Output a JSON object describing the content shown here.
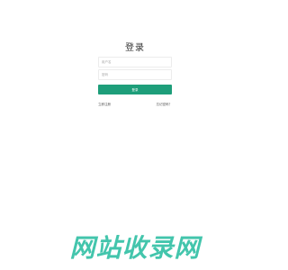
{
  "login": {
    "title": "登录",
    "username_placeholder": "用户名",
    "password_placeholder": "密码",
    "submit_label": "登录",
    "register_label": "立即注册",
    "forgot_label": "忘记密码？"
  },
  "watermark": {
    "text": "网站收录网"
  },
  "colors": {
    "accent": "#1e9e7a",
    "watermark": "#2fbfa4"
  }
}
